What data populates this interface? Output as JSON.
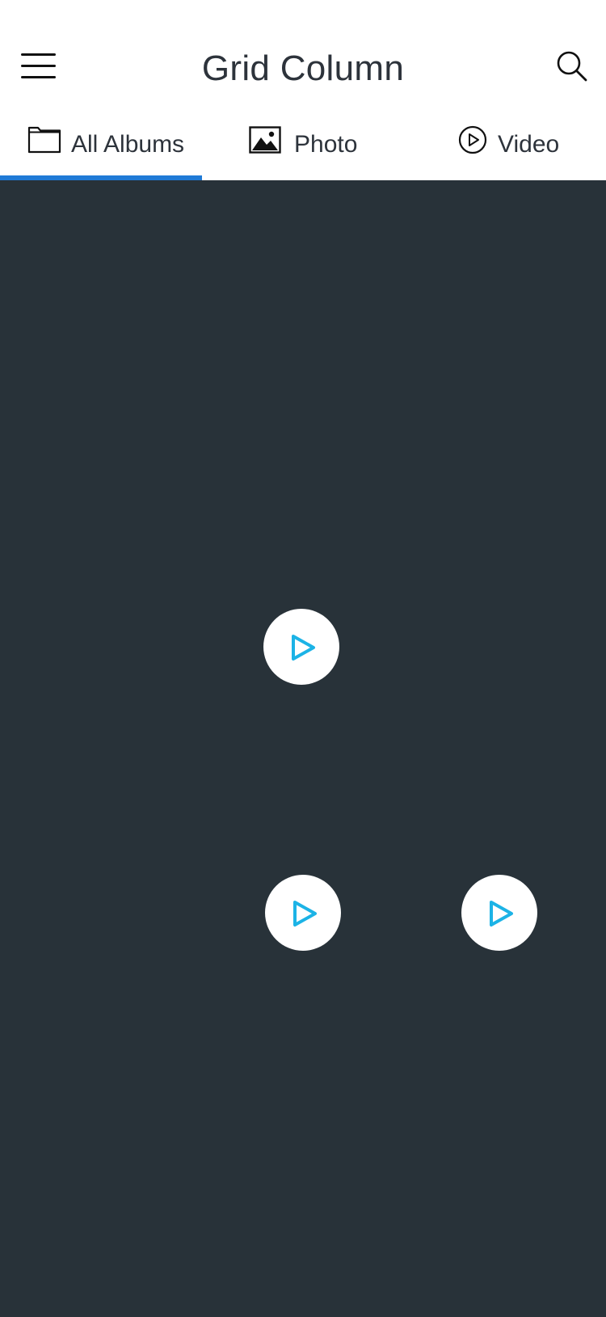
{
  "header": {
    "title": "Grid Column",
    "menu_icon": "hamburger-menu-icon",
    "search_icon": "search-icon"
  },
  "tabs": [
    {
      "label": "All Albums",
      "icon": "folder-icon",
      "active": true
    },
    {
      "label": "Photo",
      "icon": "image-icon",
      "active": false
    },
    {
      "label": "Video",
      "icon": "play-circle-icon",
      "active": false
    }
  ],
  "colors": {
    "accent": "#1f7ad6",
    "content_background": "#283239",
    "play_icon": "#1cb3e6"
  },
  "media": {
    "video_play_buttons": [
      {
        "icon": "play-icon"
      },
      {
        "icon": "play-icon"
      },
      {
        "icon": "play-icon"
      }
    ]
  }
}
